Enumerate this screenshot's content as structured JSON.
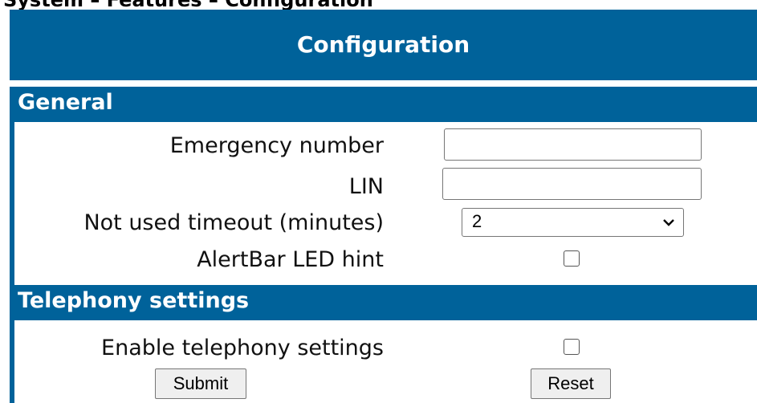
{
  "breadcrumb": "System – Features – Configuration",
  "header": {
    "title": "Configuration"
  },
  "sections": {
    "general": {
      "title": "General",
      "emergency_label": "Emergency number",
      "emergency_value": "",
      "lin_label": "LIN",
      "lin_value": "",
      "timeout_label": "Not used timeout (minutes)",
      "timeout_value": "2",
      "alertbar_label": "AlertBar LED hint",
      "alertbar_checked": false
    },
    "telephony": {
      "title": "Telephony settings",
      "enable_label": "Enable telephony settings",
      "enable_checked": false
    }
  },
  "buttons": {
    "submit": "Submit",
    "reset": "Reset"
  },
  "colors": {
    "header_bg": "#00629a",
    "header_text": "#ffffff"
  }
}
